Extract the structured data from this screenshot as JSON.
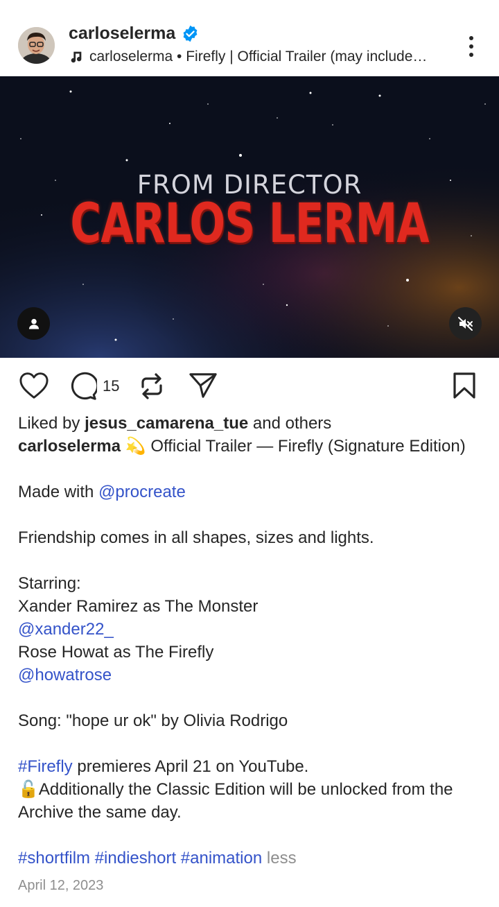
{
  "post": {
    "username": "carloselerma",
    "audio": "carloselerma • Firefly | Official Trailer (may include…",
    "video_overlay": {
      "line1": "FROM DIRECTOR",
      "line2": "CARLOS LERMA"
    }
  },
  "actions": {
    "comment_count": "15"
  },
  "likes": {
    "prefix": "Liked by ",
    "user": "jesus_camarena_tue",
    "suffix": " and others"
  },
  "caption": {
    "author": "carloselerma",
    "title": " 💫 Official Trailer — Firefly (Signature Edition)",
    "made_with": "Made with ",
    "procreate": "@procreate",
    "friendship": "Friendship comes in all shapes, sizes and lights.",
    "starring": "Starring:",
    "cast1": "Xander Ramirez as The Monster",
    "cast1_handle": "@xander22_",
    "cast2": "Rose Howat as The Firefly",
    "cast2_handle": "@howatrose",
    "song": "Song: \"hope ur ok\" by Olivia Rodrigo",
    "hashtag_firefly": "#Firefly",
    "premiere": " premieres April 21 on YouTube.",
    "archive": "🔓Additionally the Classic Edition will be unlocked from the Archive the same day.",
    "tag1": "#shortfilm",
    "tag2": "#indieshort",
    "tag3": "#animation",
    "less": "less"
  },
  "date": "April 12, 2023",
  "colors": {
    "link": "#3453c9",
    "verified": "#0095f6",
    "title_red": "#e0291f"
  }
}
